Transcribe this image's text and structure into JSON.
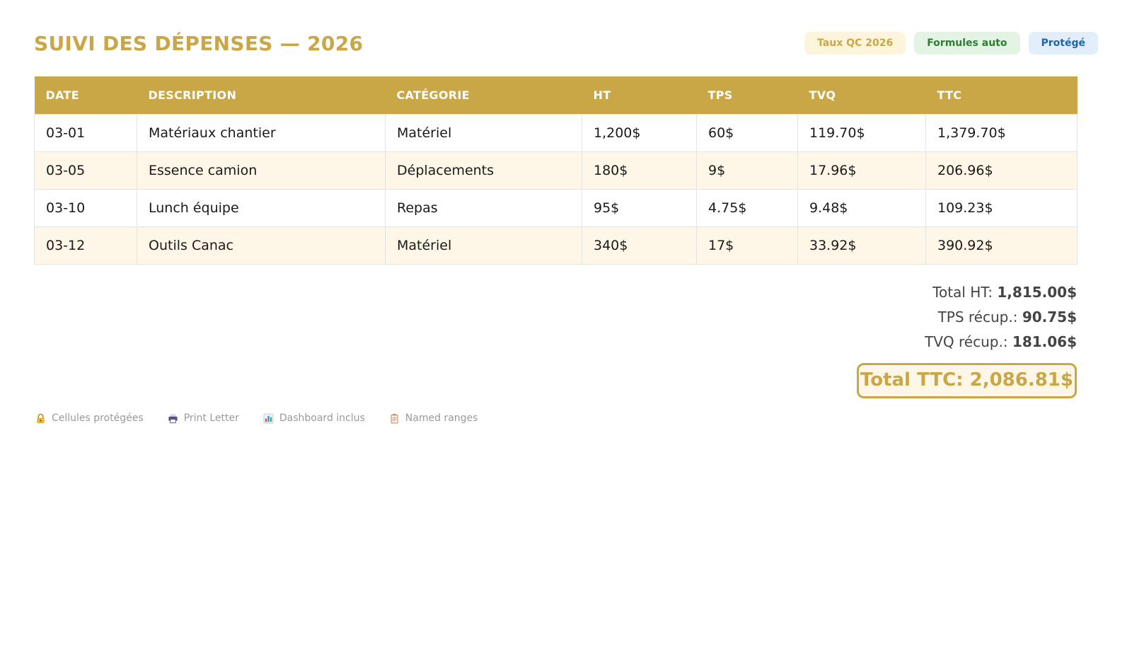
{
  "header": {
    "title": "SUIVI DES DÉPENSES — 2026",
    "badges": [
      {
        "label": "Taux QC 2026"
      },
      {
        "label": "Formules auto"
      },
      {
        "label": "Protégé"
      }
    ]
  },
  "table": {
    "columns": [
      "DATE",
      "DESCRIPTION",
      "CATÉGORIE",
      "HT",
      "TPS",
      "TVQ",
      "TTC"
    ],
    "rows": [
      [
        "03-01",
        "Matériaux chantier",
        "Matériel",
        "1,200$",
        "60$",
        "119.70$",
        "1,379.70$"
      ],
      [
        "03-05",
        "Essence camion",
        "Déplacements",
        "180$",
        "9$",
        "17.96$",
        "206.96$"
      ],
      [
        "03-10",
        "Lunch équipe",
        "Repas",
        "95$",
        "4.75$",
        "9.48$",
        "109.23$"
      ],
      [
        "03-12",
        "Outils Canac",
        "Matériel",
        "340$",
        "17$",
        "33.92$",
        "390.92$"
      ]
    ]
  },
  "summary": {
    "total_ht_label": "Total HT:",
    "total_ht_value": "1,815.00$",
    "tps_label": "TPS récup.:",
    "tps_value": "90.75$",
    "tvq_label": "TVQ récup.:",
    "tvq_value": "181.06$",
    "total_ttc": "Total TTC: 2,086.81$"
  },
  "footer": {
    "items": [
      {
        "icon": "lock-icon",
        "label": "Cellules protégées"
      },
      {
        "icon": "printer-icon",
        "label": "Print Letter"
      },
      {
        "icon": "bar-chart-icon",
        "label": "Dashboard inclus"
      },
      {
        "icon": "clipboard-icon",
        "label": "Named ranges"
      }
    ]
  },
  "colors": {
    "accent": "#c9a646",
    "row_alt": "#fef7e8"
  }
}
